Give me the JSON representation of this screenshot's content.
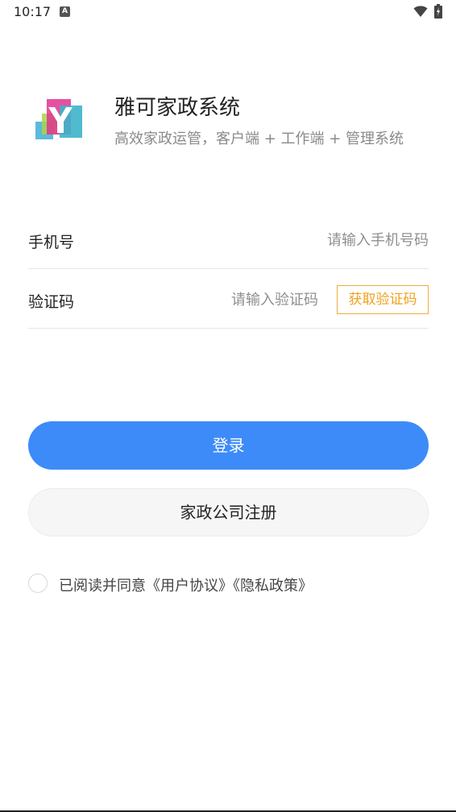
{
  "status_bar": {
    "time": "10:17",
    "notification_icon": "A"
  },
  "app": {
    "logo_icon": "y-logo-icon",
    "title": "雅可家政系统",
    "subtitle": "高效家政运管，客户端 + 工作端 + 管理系统"
  },
  "form": {
    "phone_label": "手机号",
    "phone_placeholder": "请输入手机号码",
    "phone_value": "",
    "code_label": "验证码",
    "code_placeholder": "请输入验证码",
    "code_value": "",
    "get_code_label": "获取验证码"
  },
  "buttons": {
    "login_label": "登录",
    "register_label": "家政公司注册"
  },
  "agreement": {
    "prefix": "已阅读并同意",
    "user_agreement": "《用户协议》",
    "privacy_policy": "《隐私政策》",
    "checked": false
  },
  "colors": {
    "primary": "#3d8bf8",
    "accent": "#f0a020"
  }
}
